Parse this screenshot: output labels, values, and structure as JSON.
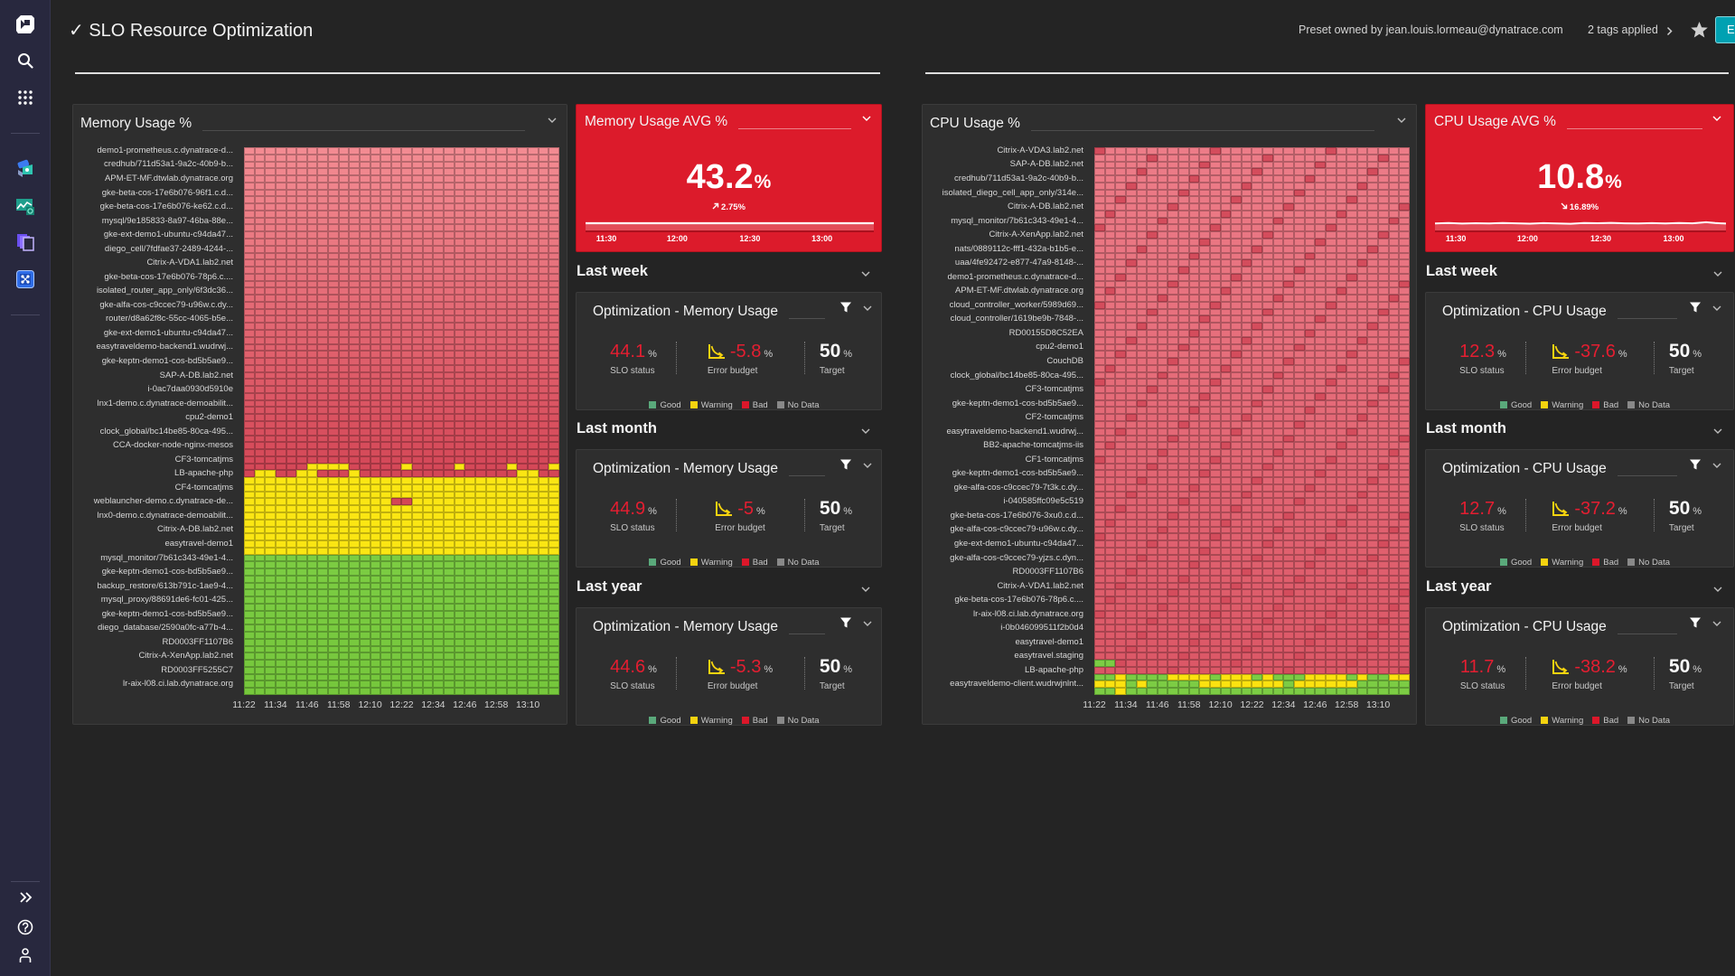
{
  "sidebar": {
    "top_icons": [
      "dynatrace-logo-icon",
      "search-icon",
      "apps-grid-icon"
    ],
    "app_icons": [
      "infrastructure-app-icon",
      "dashboards-app-icon",
      "layers-app-icon",
      "workflows-app-icon"
    ],
    "bottom_icons": [
      "expand-icon",
      "help-icon",
      "user-icon"
    ]
  },
  "header": {
    "title": "✓ SLO Resource Optimization",
    "owner_text": "Preset owned by jean.louis.lormeau@dynatrace.com",
    "tags_text": "2 tags applied",
    "edit_button_label": "E",
    "accent_color": "#00a1b2"
  },
  "labels": {
    "unit": "%",
    "slo_status": "SLO status",
    "error_budget": "Error budget",
    "target": "Target"
  },
  "legend": [
    {
      "label": "Good",
      "color": "#5aa97b"
    },
    {
      "label": "Warning",
      "color": "#f5d30f"
    },
    {
      "label": "Bad",
      "color": "#dc172a"
    },
    {
      "label": "No Data",
      "color": "#898989"
    }
  ],
  "memory": {
    "heatmap_title": "Memory Usage %",
    "avg": {
      "title": "Memory Usage AVG %",
      "value": "43.2",
      "unit": "%",
      "change": "2.75%",
      "trend": "up",
      "times": [
        "11:30",
        "12:00",
        "12:30",
        "13:00"
      ]
    },
    "slo": [
      {
        "period": "Last week",
        "title": "Optimization - Memory Usage",
        "slo_status": "44.1",
        "error_budget": "-5.8",
        "target": "50"
      },
      {
        "period": "Last month",
        "title": "Optimization - Memory Usage",
        "slo_status": "44.9",
        "error_budget": "-5",
        "target": "50"
      },
      {
        "period": "Last year",
        "title": "Optimization - Memory Usage",
        "slo_status": "44.6",
        "error_budget": "-5.3",
        "target": "50"
      }
    ]
  },
  "cpu": {
    "heatmap_title": "CPU Usage %",
    "avg": {
      "title": "CPU Usage AVG %",
      "value": "10.8",
      "unit": "%",
      "change": "16.89%",
      "trend": "down",
      "times": [
        "11:30",
        "12:00",
        "12:30",
        "13:00"
      ]
    },
    "slo": [
      {
        "period": "Last week",
        "title": "Optimization - CPU Usage",
        "slo_status": "12.3",
        "error_budget": "-37.6",
        "target": "50"
      },
      {
        "period": "Last month",
        "title": "Optimization - CPU Usage",
        "slo_status": "12.7",
        "error_budget": "-37.2",
        "target": "50"
      },
      {
        "period": "Last year",
        "title": "Optimization - CPU Usage",
        "slo_status": "11.7",
        "error_budget": "-38.2",
        "target": "50"
      }
    ]
  },
  "chart_data": [
    {
      "type": "heatmap",
      "title": "Memory Usage %",
      "columns": 30,
      "x_ticks": [
        "11:22",
        "11:34",
        "11:46",
        "11:58",
        "12:10",
        "12:22",
        "12:34",
        "12:46",
        "12:58",
        "13:10"
      ],
      "status_legend": {
        "R": "Bad",
        "Y": "Warning",
        "G": "Good"
      },
      "y_labels": [
        "demo1-prometheus.c.dynatrace-d...",
        "credhub/711d53a1-9a2c-40b9-b...",
        "APM-ET-MF.dtwlab.dynatrace.org",
        "gke-beta-cos-17e6b076-96f1.c.d...",
        "gke-beta-cos-17e6b076-ke62.c.d...",
        "mysql/9e185833-8a97-46ba-88e...",
        "gke-ext-demo1-ubuntu-c94da47...",
        "diego_cell/7fdfae37-2489-4244-...",
        "Citrix-A-VDA1.lab2.net",
        "gke-beta-cos-17e6b076-78p6.c....",
        "isolated_router_app_only/6f3dc36...",
        "gke-alfa-cos-c9ccec79-u96w.c.dy...",
        "router/d8a62f8c-55cc-4065-b5e...",
        "gke-ext-demo1-ubuntu-c94da47...",
        "easytraveldemo-backend1.wudrwj...",
        "gke-keptn-demo1-cos-bd5b5ae9...",
        "SAP-A-DB.lab2.net",
        "i-0ac7daa0930d5910e",
        "lnx1-demo.c.dynatrace-demoabilit...",
        "cpu2-demo1",
        "clock_global/bc14be85-80ca-495...",
        "CCA-docker-node-nginx-mesos",
        "CF3-tomcatjms",
        "LB-apache-php",
        "CF4-tomcatjms",
        "weblauncher-demo.c.dynatrace-de...",
        "lnx0-demo.c.dynatrace-demoabilit...",
        "Citrix-A-DB.lab2.net",
        "easytravel-demo1",
        "mysql_monitor/7b61c343-49e1-4...",
        "gke-keptn-demo1-cos-bd5b5ae9...",
        "backup_restore/613b791c-1ae9-4...",
        "mysql_proxy/88691de6-fc01-425...",
        "gke-keptn-demo1-cos-bd5b5ae9...",
        "diego_database/2590a0fc-a77b-4...",
        "RD0003FF1107B6",
        "Citrix-A-XenApp.lab2.net",
        "RD0003FF5255C7",
        "lr-aix-l08.ci.lab.dynatrace.org"
      ],
      "rows": [
        {
          "cells": "RRRRRRRRRRRRRRRRRRRRRRRRRRRRRR",
          "repeat": 45
        },
        {
          "cells": "RRRRRRYYYYRRRRRYRRRRYRRRRYRRRY",
          "repeat": 1
        },
        {
          "cells": "RYYRRYYRRRYRRRRRRRRRRRRRRRYYRR",
          "repeat": 1
        },
        {
          "cells": "YYYYYYYYYYYYYYYYYYYYYYYYYYYYYY",
          "repeat": 3
        },
        {
          "cells": "YYYYYYYYYYYYYYRRYYYYYYYYYYYYYY",
          "repeat": 1
        },
        {
          "cells": "YYYYYYYYYYYYYYYYYYYYYYYYYYYYYY",
          "repeat": 7
        },
        {
          "cells": "GGGGGGGGGGGGGGGGGGGGGGGGGGGGGG",
          "repeat": 20
        }
      ]
    },
    {
      "type": "heatmap",
      "title": "CPU Usage %",
      "columns": 30,
      "x_ticks": [
        "11:22",
        "11:34",
        "11:46",
        "11:58",
        "12:10",
        "12:22",
        "12:34",
        "12:46",
        "12:58",
        "13:10"
      ],
      "status_legend": {
        "R": "Bad",
        "Y": "Warning",
        "G": "Good"
      },
      "y_labels": [
        "Citrix-A-VDA3.lab2.net",
        "SAP-A-DB.lab2.net",
        "credhub/711d53a1-9a2c-40b9-b...",
        "isolated_diego_cell_app_only/314e...",
        "Citrix-A-DB.lab2.net",
        "mysql_monitor/7b61c343-49e1-4...",
        "Citrix-A-XenApp.lab2.net",
        "nats/0889112c-fff1-432a-b1b5-e...",
        "uaa/4fe92472-e877-47a9-8148-...",
        "demo1-prometheus.c.dynatrace-d...",
        "APM-ET-MF.dtwlab.dynatrace.org",
        "cloud_controller_worker/5989d69...",
        "cloud_controller/1619be9b-7848-...",
        "RD00155D8C52EA",
        "cpu2-demo1",
        "CouchDB",
        "clock_global/bc14be85-80ca-495...",
        "CF3-tomcatjms",
        "gke-keptn-demo1-cos-bd5b5ae9...",
        "CF2-tomcatjms",
        "easytraveldemo-backend1.wudrwj...",
        "BB2-apache-tomcatjms-iis",
        "CF1-tomcatjms",
        "gke-keptn-demo1-cos-bd5b5ae9...",
        "gke-alfa-cos-c9ccec79-7t3k.c.dy...",
        "i-040585ffc09e5c519",
        "gke-beta-cos-17e6b076-3xu0.c.d...",
        "gke-alfa-cos-c9ccec79-u96w.c.dy...",
        "gke-ext-demo1-ubuntu-c94da47...",
        "gke-alfa-cos-c9ccec79-yjzs.c.dyn...",
        "RD0003FF1107B6",
        "Citrix-A-VDA1.lab2.net",
        "gke-beta-cos-17e6b076-78p6.c....",
        "lr-aix-l08.ci.lab.dynatrace.org",
        "i-0b046099511f2b0d4",
        "easytravel-demo1",
        "easytravel.staging",
        "LB-apache-php",
        "easytraveldemo-client.wudrwjnlnt..."
      ],
      "rows": [
        {
          "cells": "RRRRRRRRRRRRRRRRRRRRRRRRRRRRRR",
          "repeat": 73
        },
        {
          "cells": "GGRRRRRRRRRRRRRRRRRRRRRRRRRRRR",
          "repeat": 1
        },
        {
          "cells": "RRRRRRRRRRRRRRRRRRRRRRRRRRRRRR",
          "repeat": 1
        },
        {
          "cells": "GGYGGGGYYYYGYYYGYGGGYYYYGYGGYY",
          "repeat": 1
        },
        {
          "cells": "YYYGYGGGGGYYYYYYYYGYYYYYYGGGGG",
          "repeat": 1
        },
        {
          "cells": "GGYGGGGGGGGGGGGGGGGGGGGGGGGGGG",
          "repeat": 1
        }
      ]
    }
  ]
}
